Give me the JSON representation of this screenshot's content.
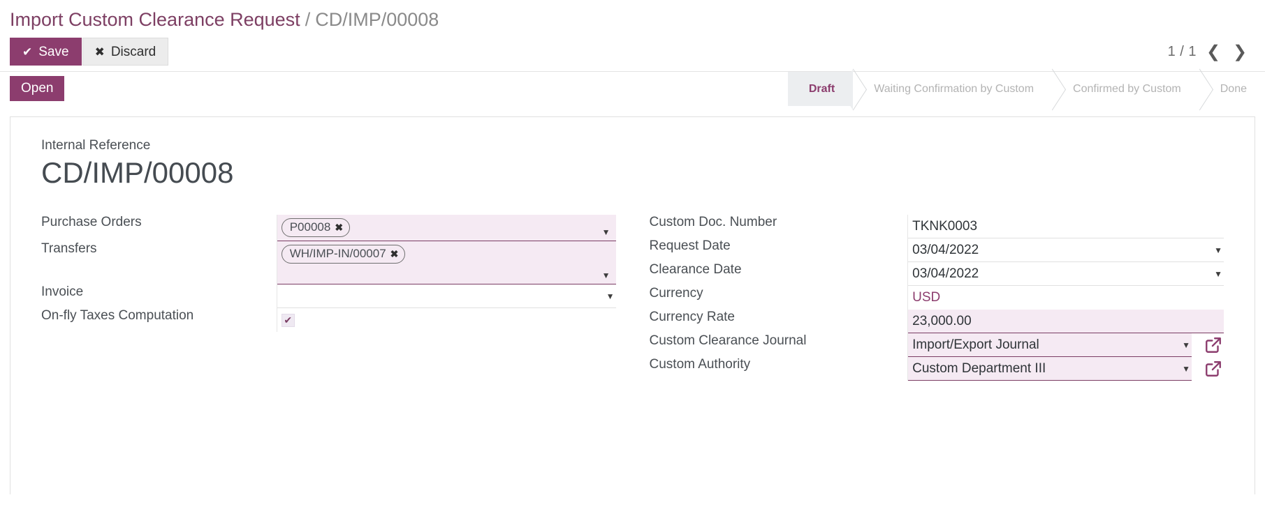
{
  "breadcrumb": {
    "root": "Import Custom Clearance Request",
    "separator": "/",
    "current": "CD/IMP/00008"
  },
  "toolbar": {
    "save_label": "Save",
    "save_icon": "check-icon",
    "discard_label": "Discard",
    "discard_icon": "times-icon"
  },
  "pager": {
    "count": "1 / 1",
    "prev_icon": "chevron-left-icon",
    "next_icon": "chevron-right-icon"
  },
  "statusbar": {
    "open_button": "Open",
    "steps": [
      {
        "label": "Draft",
        "active": true
      },
      {
        "label": "Waiting Confirmation by Custom",
        "active": false
      },
      {
        "label": "Confirmed by Custom",
        "active": false
      },
      {
        "label": "Done",
        "active": false
      }
    ]
  },
  "title": {
    "label": "Internal Reference",
    "value": "CD/IMP/00008"
  },
  "left_column": {
    "purchase_orders": {
      "label": "Purchase Orders",
      "tags": [
        "P00008"
      ],
      "tag_remove_icon": "times-icon",
      "caret_icon": "caret-down-icon"
    },
    "transfers": {
      "label": "Transfers",
      "tags": [
        "WH/IMP-IN/00007"
      ],
      "tag_remove_icon": "times-icon",
      "caret_icon": "caret-down-icon"
    },
    "invoice": {
      "label": "Invoice",
      "value": "",
      "caret_icon": "caret-down-icon"
    },
    "onfly_taxes": {
      "label": "On-fly Taxes Computation",
      "checked": true,
      "check_icon": "check-icon"
    }
  },
  "right_column": {
    "custom_doc_number": {
      "label": "Custom Doc. Number",
      "value": "TKNK0003"
    },
    "request_date": {
      "label": "Request Date",
      "value": "03/04/2022",
      "caret_icon": "caret-down-icon"
    },
    "clearance_date": {
      "label": "Clearance Date",
      "value": "03/04/2022",
      "caret_icon": "caret-down-icon"
    },
    "currency": {
      "label": "Currency",
      "value": "USD"
    },
    "currency_rate": {
      "label": "Currency Rate",
      "value": "23,000.00"
    },
    "custom_clearance_journal": {
      "label": "Custom Clearance Journal",
      "value": "Import/Export Journal",
      "caret_icon": "caret-down-icon",
      "link_icon": "external-link-icon"
    },
    "custom_authority": {
      "label": "Custom Authority",
      "value": "Custom Department III",
      "caret_icon": "caret-down-icon",
      "link_icon": "external-link-icon"
    }
  },
  "colors": {
    "brand_purple": "#8c3d6e",
    "field_pink": "#f5eaf3",
    "field_underline": "#7a3c63",
    "muted_gray": "#b3b3b3"
  }
}
